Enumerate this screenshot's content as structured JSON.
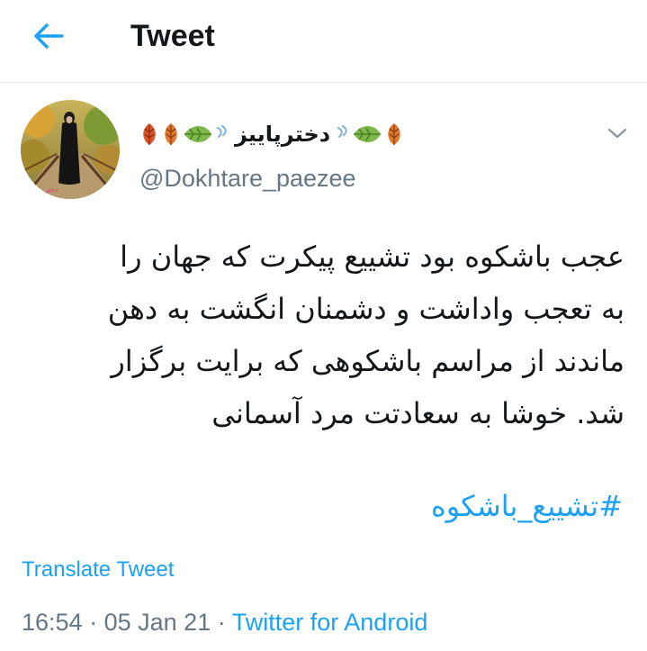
{
  "header": {
    "title": "Tweet",
    "back_icon": "arrow-left-icon",
    "accent_color": "#1da1f2"
  },
  "tweet": {
    "author": {
      "display_name": "دخترپاییز",
      "handle": "@Dokhtare_paezee",
      "avatar_watermark": "دختر پاییز",
      "name_decorations": [
        "leaf-icon",
        "leaf-icon",
        "leaf-icon",
        "wind-icon"
      ]
    },
    "text_lines": [
      "عجب باشکوه بود تشییع پیکرت که جهان را",
      "به تعجب واداشت و دشمنان انگشت به دهن",
      "ماندند از مراسم باشکوهی که برایت برگزار",
      "شد. خوشا به سعادتت مرد آسمانی"
    ],
    "hashtag": "#تشییع_باشکوه",
    "translate_label": "Translate Tweet",
    "time": "16:54",
    "separator": "·",
    "date": "05 Jan 21",
    "source": "Twitter for Android",
    "menu_icon": "chevron-down-icon"
  },
  "colors": {
    "primary_text": "#14171a",
    "secondary_text": "#657786",
    "link": "#1da1f2",
    "divider": "#e6ecf0"
  }
}
